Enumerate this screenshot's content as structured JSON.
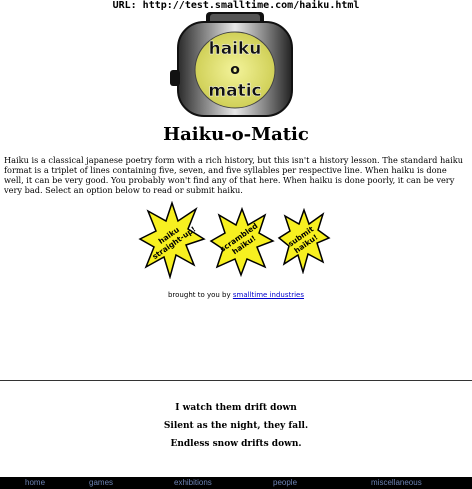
{
  "url_label": "URL: http://test.smalltime.com/haiku.html",
  "logo": {
    "line1": "haiku",
    "line2": "o",
    "line3": "matic"
  },
  "title": "Haiku-o-Matic",
  "intro": "Haiku is a classical japanese poetry form with a rich history, but this isn't a history lesson. The standard haiku format is a triplet of lines containing five, seven, and five syllables per respective line. When haiku is done well, it can be very good. You probably won't find any of that here. When haiku is done poorly, it can be very very bad. Select an option below to read or submit haiku.",
  "options": [
    {
      "line1": "haiku",
      "line2": "straight-up!"
    },
    {
      "line1": "scrambled",
      "line2": "haiku!"
    },
    {
      "line1": "submit",
      "line2": "haiku!"
    }
  ],
  "credit": {
    "prefix": "brought to you by",
    "link": "smalltime industries"
  },
  "haiku_lines": [
    "I watch them drift down",
    "Silent as the night, they fall.",
    "Endless snow drifts down."
  ],
  "nav": [
    "home",
    "games",
    "exhibitions",
    "people",
    "miscellaneous"
  ],
  "colors": {
    "star_fill": "#f7f020",
    "nav_bg": "#000000",
    "nav_text": "#6f84b5",
    "link": "#0000cc"
  }
}
